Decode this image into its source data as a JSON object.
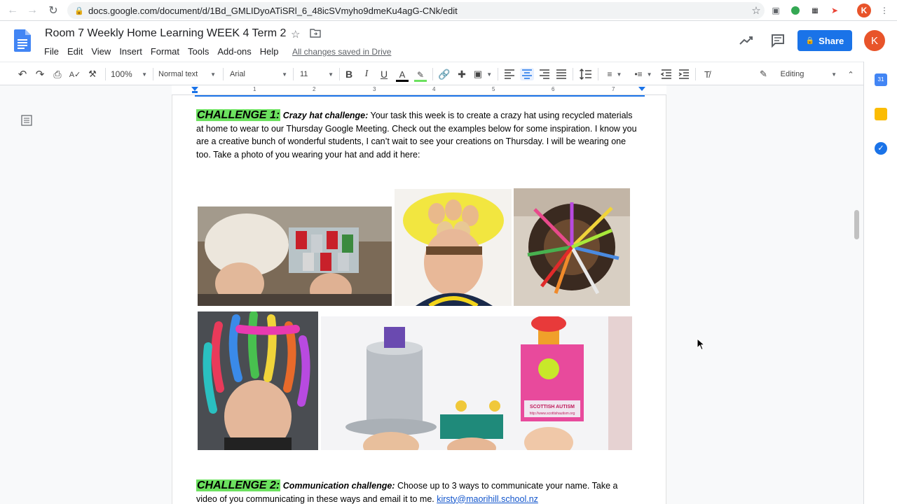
{
  "browser": {
    "url": "docs.google.com/document/d/1Bd_GMLIDyoATiSRl_6_48icSVmyho9dmeKu4agG-CNk/edit",
    "profile_initial": "K"
  },
  "header": {
    "title": "Room 7 Weekly Home Learning WEEK 4 Term 2",
    "menu": [
      "File",
      "Edit",
      "View",
      "Insert",
      "Format",
      "Tools",
      "Add-ons",
      "Help"
    ],
    "save_status": "All changes saved in Drive",
    "share_label": "Share",
    "user_initial": "K",
    "brand_color": "#1a73e8"
  },
  "toolbar": {
    "zoom": "100%",
    "style": "Normal text",
    "font": "Arial",
    "size": "11",
    "mode": "Editing"
  },
  "ruler": {
    "numbers": [
      "1",
      "2",
      "3",
      "4",
      "5",
      "6",
      "7"
    ]
  },
  "document": {
    "challenge1": {
      "heading": "CHALLENGE 1:",
      "subheading": "Crazy hat challenge:",
      "text": " Your task this week is to create a crazy hat using recycled materials at home to wear to our Thursday Google Meeting. Check out the examples below for some inspiration. I know you are a creative bunch of wonderful students, I can’t wait to see your creations on Thursday. I will be wearing one too.  Take a photo of you wearing your hat and add it here:"
    },
    "photos": {
      "badge_text": "SCOTTISH AUTISM",
      "badge_url": "http://www.scottishautism.org"
    },
    "challenge2": {
      "heading": "CHALLENGE 2:",
      "subheading": "Communication challenge:",
      "text": " Choose up to 3 ways to communicate your name. Take a video of you communicating in these ways and email it to me. ",
      "email": "kirsty@maorihill.school.nz"
    },
    "highlight_color": "#6ce15f"
  }
}
